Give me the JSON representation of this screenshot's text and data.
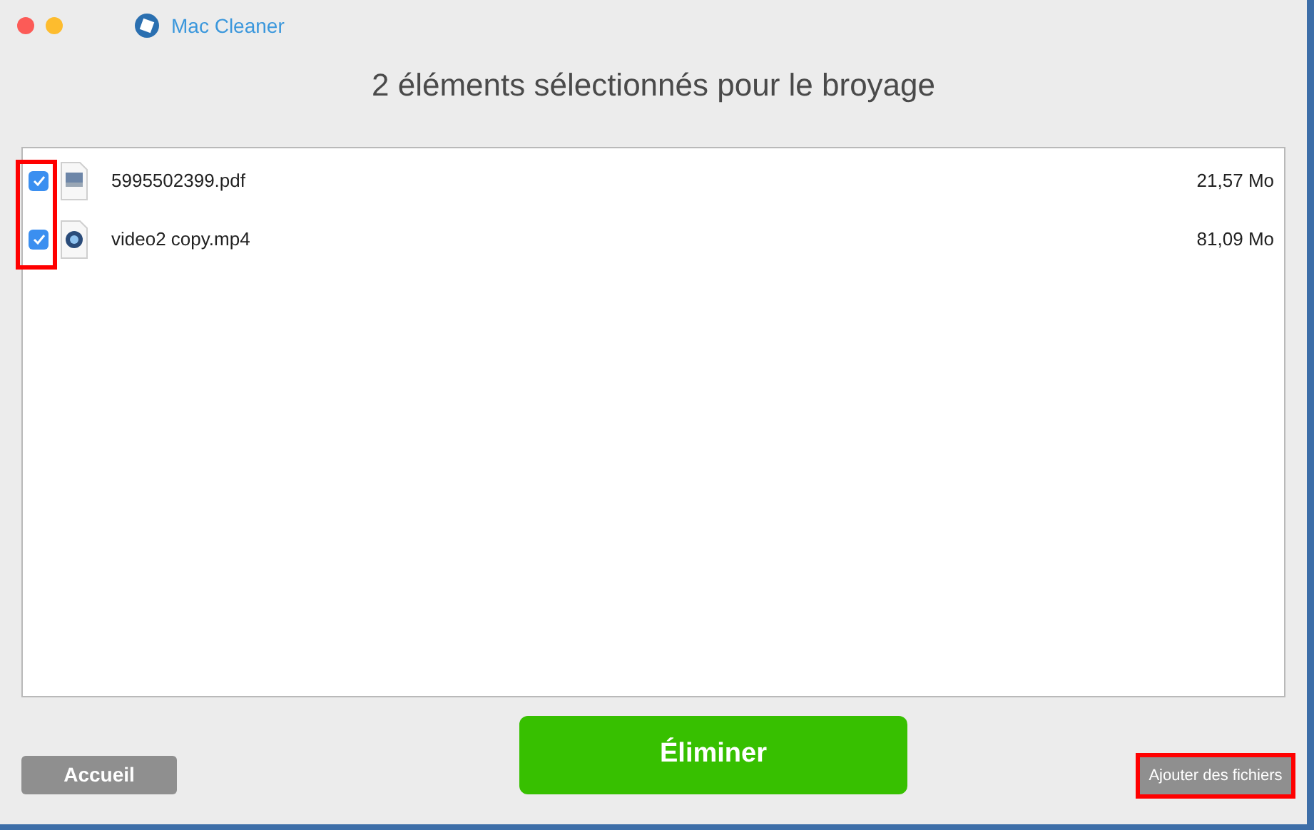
{
  "window": {
    "title": "Mac Cleaner"
  },
  "heading": "2 éléments sélectionnés pour le broyage",
  "files": [
    {
      "kind": "pdf",
      "name": "5995502399.pdf",
      "size": "21,57 Mo",
      "checked": true
    },
    {
      "kind": "video",
      "name": "video2 copy.mp4",
      "size": "81,09 Mo",
      "checked": true
    }
  ],
  "buttons": {
    "home": "Accueil",
    "erase": "Éliminer",
    "add": "Ajouter des fichiers"
  }
}
